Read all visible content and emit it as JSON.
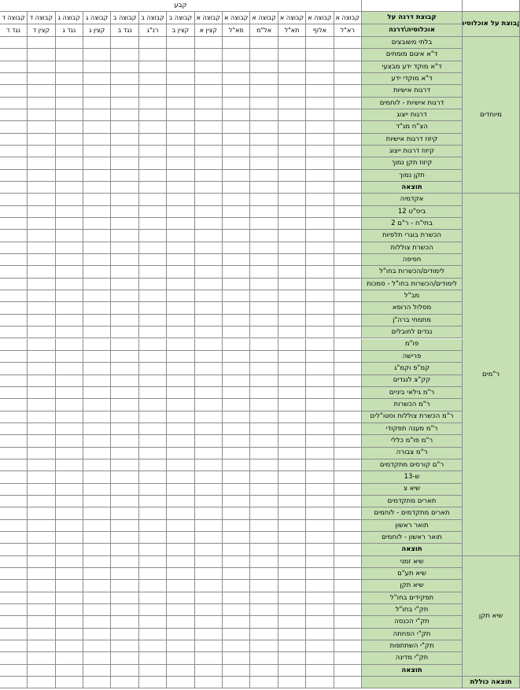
{
  "header": {
    "top_label": "קבע",
    "col_title_row1": "קבוצת דרגה על",
    "col_title_row2": "אוכלוסיה\\דרגה",
    "row_group_title": "קבוצת על אוכלוסיה",
    "columns": [
      {
        "group": "קבוצה א",
        "rank": "רא\"ל"
      },
      {
        "group": "קבוצה א",
        "rank": "אלוף"
      },
      {
        "group": "קבוצה א",
        "rank": "תא\"ל"
      },
      {
        "group": "קבוצה א",
        "rank": "אל\"מ"
      },
      {
        "group": "קבוצה א",
        "rank": "סא\"ל"
      },
      {
        "group": "קבוצה א",
        "rank": "קצין א"
      },
      {
        "group": "קבוצה ב",
        "rank": "קצין ב"
      },
      {
        "group": "קבוצה ב",
        "rank": "רנ\"ג"
      },
      {
        "group": "קבוצה ב",
        "rank": "נגד ב"
      },
      {
        "group": "קבוצה ג",
        "rank": "קצין ג"
      },
      {
        "group": "קבוצה ג",
        "rank": "נגד ג"
      },
      {
        "group": "קבוצה ד",
        "rank": "קצין ד"
      },
      {
        "group": "קבוצה ד",
        "rank": "נגד ד"
      }
    ]
  },
  "groups": [
    {
      "name": "מיוחדים",
      "rows": [
        "בלתי משובצים",
        "ד\"א איגום מומחים",
        "ד\"א מוקד ידע מבצעי",
        "ד\"א מוקדי ידע",
        "דרגות אישיות",
        "דרגות אישיות - לוחמים",
        "דרגות ייצוג",
        "הצ\"ח מג\"ד",
        "קיזוז דרגות אישיות",
        "קיזוז דרגות ייצוג",
        "קיזוז תקן נמוך",
        "תקן נמוך"
      ],
      "total": "תוצאה"
    },
    {
      "name": "ר\"מים",
      "rows": [
        "אקדמיה",
        "ביס\"ט 12",
        "בתי\"ח - ר\"ם 2",
        "הכשרת בוגרי תלפיות",
        "הכשרת צוללות",
        "חפיפה",
        "לימודים/הכשרות בחו\"ל",
        "לימודים/הכשרות בחו\"ל - סמכות",
        "מב\"ל",
        "מסלול הרופא",
        "מתמחי ברה\"ן",
        "נגדים לחובלים",
        "פו\"מ",
        "פרישה",
        "קמ\"פ וקמ\"ג",
        "קק\"צ לנגדים",
        "ר\"מ גילאי ביניים",
        "ר\"מ הכשרות",
        "ר\"מ הכשרת צוללות וסטו\"לים",
        "ר\"מ מענה תפקודי",
        "ר\"מ פו\"מ כללי",
        "ר\"מ צבורה",
        "ר\"ם קורסים מתקדמים",
        "ש-13",
        "שיא צ",
        "תארים מתקדמים",
        "תארים מתקדמים - לוחמים",
        "תואר ראשון",
        "תואר ראשון - לוחמים"
      ],
      "total": "תוצאה"
    },
    {
      "name": "שיא תקן",
      "rows": [
        "שיא זמני",
        "שיא תע\"ם",
        "שיא תקן",
        "תפקידים בחו\"ל",
        "תק\"י בחו\"ל",
        "תק\"י הכנסה",
        "תק\"י הפחתה",
        "תק\"י השתתפות",
        "תק\"י מדינה"
      ],
      "total": "תוצאה"
    }
  ],
  "grand_total": "תוצאה כוללת",
  "colors": {
    "label_fill": "#c6e0b4",
    "grid_line": "#8c8c8c",
    "blank_fill": "#ffffff"
  }
}
